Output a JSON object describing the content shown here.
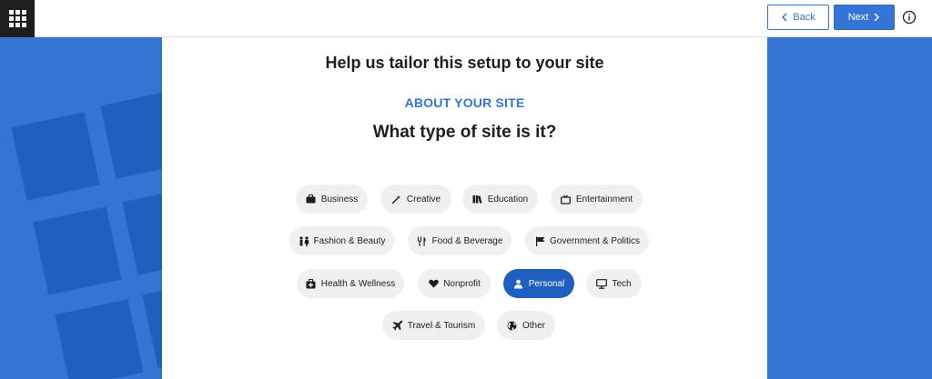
{
  "header": {
    "back_label": "Back",
    "next_label": "Next"
  },
  "main": {
    "heading": "Help us tailor this setup to your site",
    "eyebrow": "ABOUT YOUR SITE",
    "question": "What type of site is it?"
  },
  "site_types": [
    {
      "label": "Business",
      "icon": "briefcase-icon",
      "selected": false
    },
    {
      "label": "Creative",
      "icon": "magic-wand-icon",
      "selected": false
    },
    {
      "label": "Education",
      "icon": "books-icon",
      "selected": false
    },
    {
      "label": "Entertainment",
      "icon": "tv-icon",
      "selected": false
    },
    {
      "label": "Fashion & Beauty",
      "icon": "people-icon",
      "selected": false
    },
    {
      "label": "Food & Beverage",
      "icon": "utensils-icon",
      "selected": false
    },
    {
      "label": "Government & Politics",
      "icon": "flag-icon",
      "selected": false
    },
    {
      "label": "Health & Wellness",
      "icon": "medical-kit-icon",
      "selected": false
    },
    {
      "label": "Nonprofit",
      "icon": "heart-icon",
      "selected": false
    },
    {
      "label": "Personal",
      "icon": "person-icon",
      "selected": true
    },
    {
      "label": "Tech",
      "icon": "monitor-icon",
      "selected": false
    },
    {
      "label": "Travel & Tourism",
      "icon": "airplane-icon",
      "selected": false
    },
    {
      "label": "Other",
      "icon": "globe-icon",
      "selected": false
    }
  ],
  "colors": {
    "accent": "#3474d4",
    "selected_chip": "#1f5fbf",
    "chip_bg": "#f0f0f0",
    "topbar_dark": "#1e1e1e"
  }
}
